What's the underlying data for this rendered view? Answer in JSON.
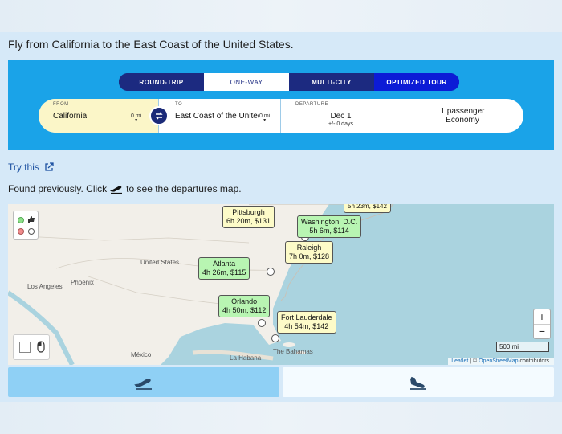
{
  "headline": "Fly from California to the East Coast of the United States.",
  "trip_tabs": [
    "ROUND-TRIP",
    "ONE-WAY",
    "MULTI-CITY",
    "OPTIMIZED TOUR"
  ],
  "form": {
    "from_label": "FROM",
    "from_value": "California",
    "from_radius": "0 mi",
    "to_label": "TO",
    "to_value": "East Coast of the United States",
    "to_radius": "0 mi",
    "departure_label": "DEPARTURE",
    "departure_date": "Dec 1",
    "departure_flex": "+/- 0 days",
    "passengers": "1 passenger",
    "cabin": "Economy"
  },
  "try_link": "Try this",
  "found_text_before": "Found previously. Click",
  "found_text_after": "to see the departures map.",
  "map": {
    "place_labels": [
      "United States",
      "Los Angeles",
      "Phoenix",
      "México",
      "La Habana",
      "The Bahamas"
    ],
    "destinations": [
      {
        "city": "Pittsburgh",
        "info": "6h 20m, $131",
        "color": "yellow"
      },
      {
        "city": "Washington, D.C.",
        "info": "5h 6m, $114",
        "color": "green"
      },
      {
        "city": "Raleigh",
        "info": "7h 0m, $128",
        "color": "yellow"
      },
      {
        "city": "Atlanta",
        "info": "4h 26m, $115",
        "color": "green"
      },
      {
        "city": "Orlando",
        "info": "4h 50m, $112",
        "color": "green"
      },
      {
        "city": "Fort Lauderdale",
        "info": "4h 54m, $142",
        "color": "yellow"
      }
    ],
    "partial_top_label": "5h 23m, $142",
    "zoom_in": "+",
    "zoom_out": "−",
    "scale": "500 mi",
    "attribution_leaflet": "Leaflet",
    "attribution_sep": " | © ",
    "attribution_osm": "OpenStreetMap",
    "attribution_end": " contributors."
  },
  "colors": {
    "panel": "#1aa3e8",
    "tab_dark": "#1c2a80",
    "tab_optimized": "#0c1bd6",
    "from_highlight": "#fbf6c8",
    "bubble_green": "#b8f5b2",
    "bubble_yellow": "#fdfbc8"
  },
  "icons": [
    "swap-icon",
    "external-link-icon",
    "departure-plane-icon",
    "arrival-plane-icon",
    "thumbs-up-icon",
    "mouse-icon"
  ]
}
